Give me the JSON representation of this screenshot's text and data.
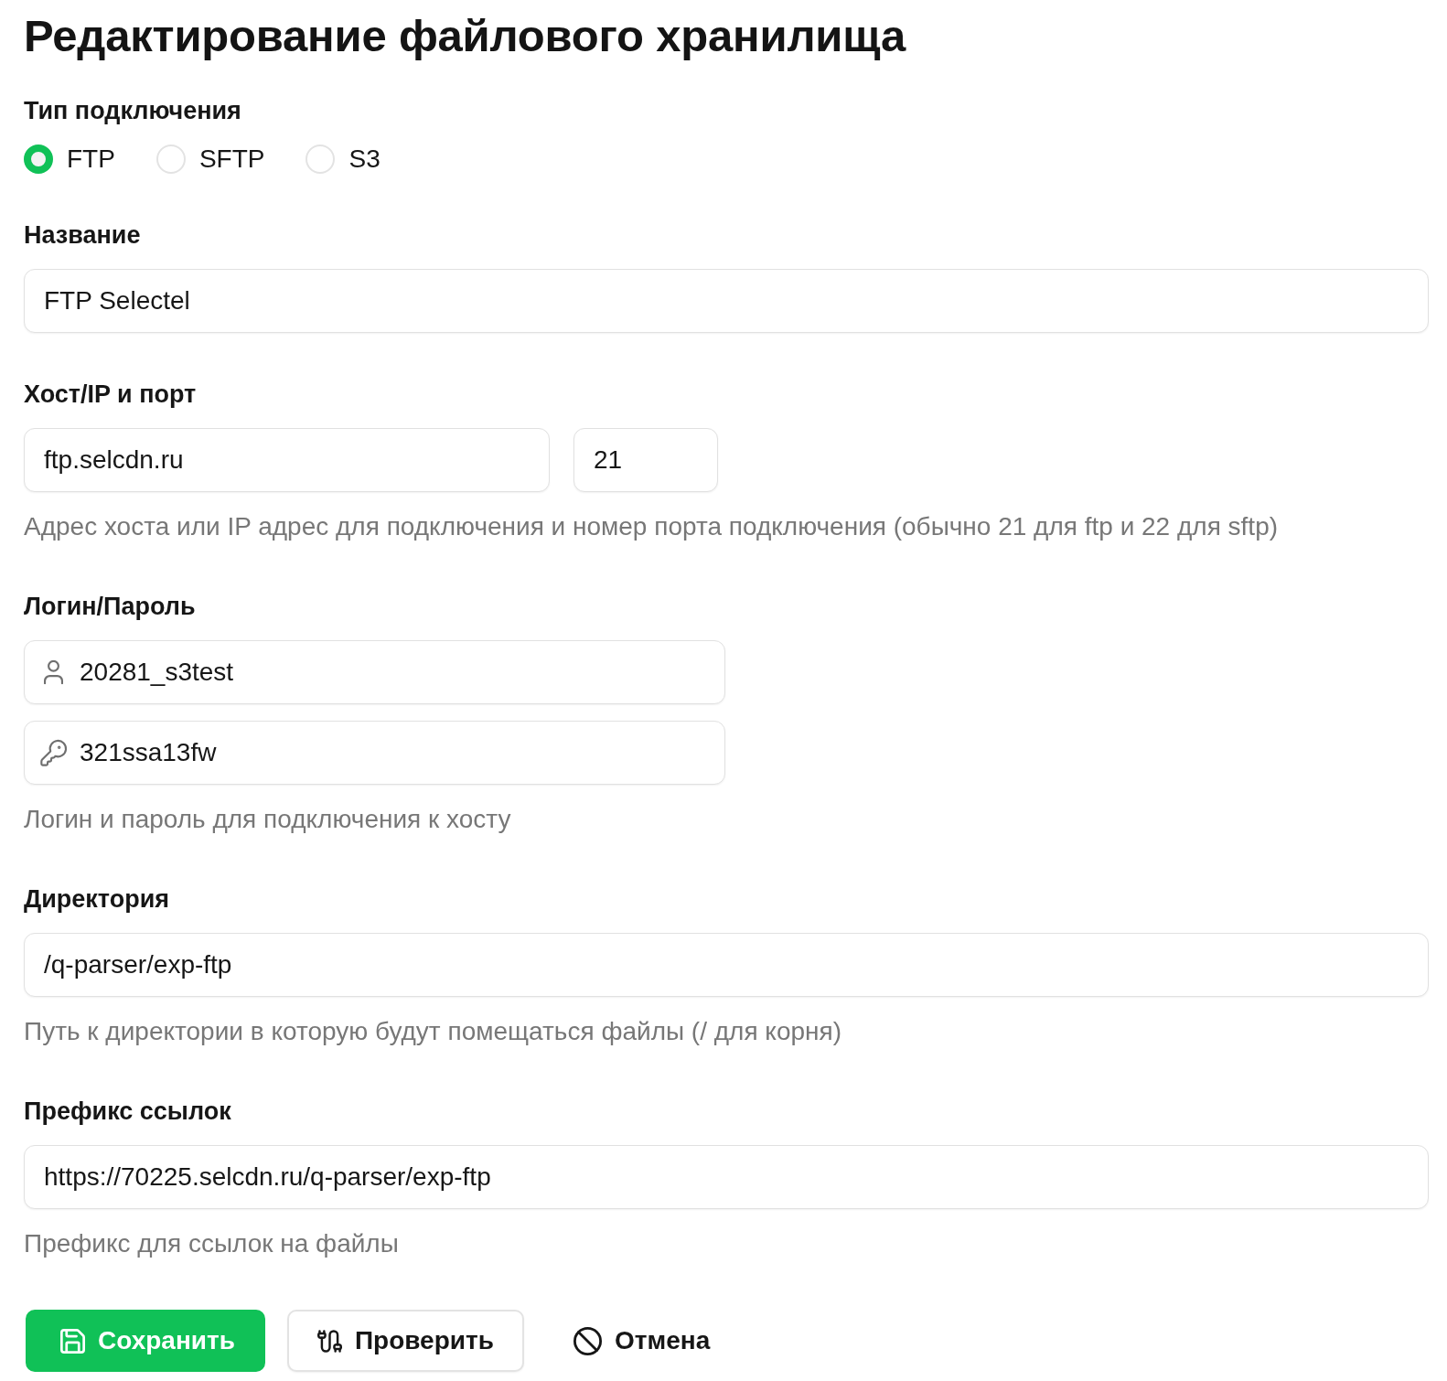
{
  "title": "Редактирование файлового хранилища",
  "connection_type": {
    "label": "Тип подключения",
    "options": [
      {
        "label": "FTP",
        "selected": true
      },
      {
        "label": "SFTP",
        "selected": false
      },
      {
        "label": "S3",
        "selected": false
      }
    ]
  },
  "sections": [
    {
      "kind": "text",
      "label": "Название",
      "value": "FTP Selectel"
    },
    {
      "kind": "host_port",
      "label": "Хост/IP и порт",
      "host": "ftp.selcdn.ru",
      "port": "21",
      "hint": "Адрес хоста или IP адрес для подключения и номер порта подключения (обычно 21 для ftp и 22 для sftp)"
    },
    {
      "kind": "credentials",
      "label": "Логин/Пароль",
      "login": "20281_s3test",
      "password": "321ssa13fw",
      "hint": "Логин и пароль для подключения к хосту"
    },
    {
      "kind": "text",
      "label": "Директория",
      "value": "/q-parser/exp-ftp",
      "hint": "Путь к директории в которую будут помещаться файлы (/ для корня)"
    },
    {
      "kind": "text",
      "label": "Префикс ссылок",
      "value": "https://70225.selcdn.ru/q-parser/exp-ftp",
      "hint": "Префикс для ссылок на файлы"
    }
  ],
  "buttons": [
    {
      "kind": "save",
      "label": "Сохранить"
    },
    {
      "kind": "test",
      "label": "Проверить"
    },
    {
      "kind": "cancel",
      "label": "Отмена"
    }
  ]
}
